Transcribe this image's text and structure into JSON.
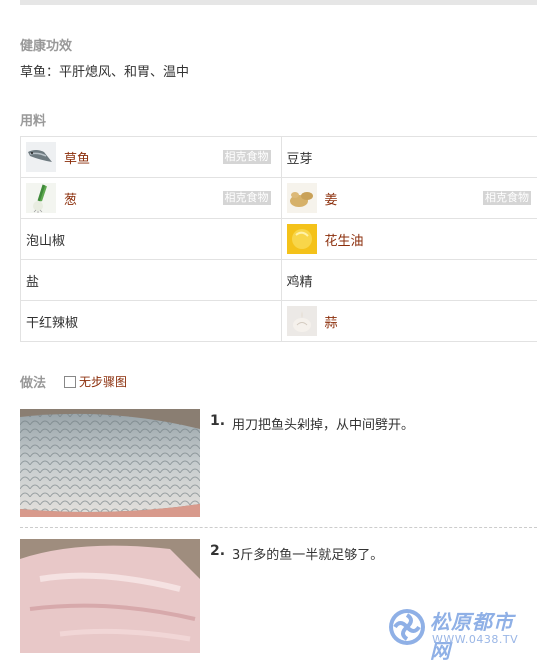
{
  "health": {
    "heading": "健康功效",
    "text": "草鱼：平肝熄风、和胃、温中"
  },
  "ingredients": {
    "heading": "用料",
    "tag": "相克食物",
    "rows": [
      [
        {
          "name": "草鱼",
          "icon": "fish-icon"
        },
        {
          "name": "豆芽"
        }
      ],
      [
        {
          "name": "葱",
          "icon": "scallion-icon"
        },
        {
          "name": "姜",
          "icon": "ginger-icon"
        }
      ],
      [
        {
          "name": "泡山椒"
        },
        {
          "name": "花生油",
          "icon": "peanut-oil-icon"
        }
      ],
      [
        {
          "name": "盐"
        },
        {
          "name": "鸡精"
        }
      ],
      [
        {
          "name": "干红辣椒"
        },
        {
          "name": "蒜",
          "icon": "garlic-icon"
        }
      ]
    ]
  },
  "method": {
    "heading": "做法",
    "checkbox_label": "无步骤图",
    "steps": [
      {
        "num": "1.",
        "text": "用刀把鱼头剁掉，从中间劈开。",
        "image": "fish-scales-photo"
      },
      {
        "num": "2.",
        "text": "3斤多的鱼一半就足够了。",
        "image": "fish-fillet-photo"
      }
    ]
  },
  "watermark": {
    "name": "松原都市网",
    "url": "WWW.0438.TV"
  },
  "colors": {
    "link": "#8b2e0b",
    "heading": "#999999",
    "tag_bg": "#d5d5d5",
    "border": "#e2e2e2"
  }
}
